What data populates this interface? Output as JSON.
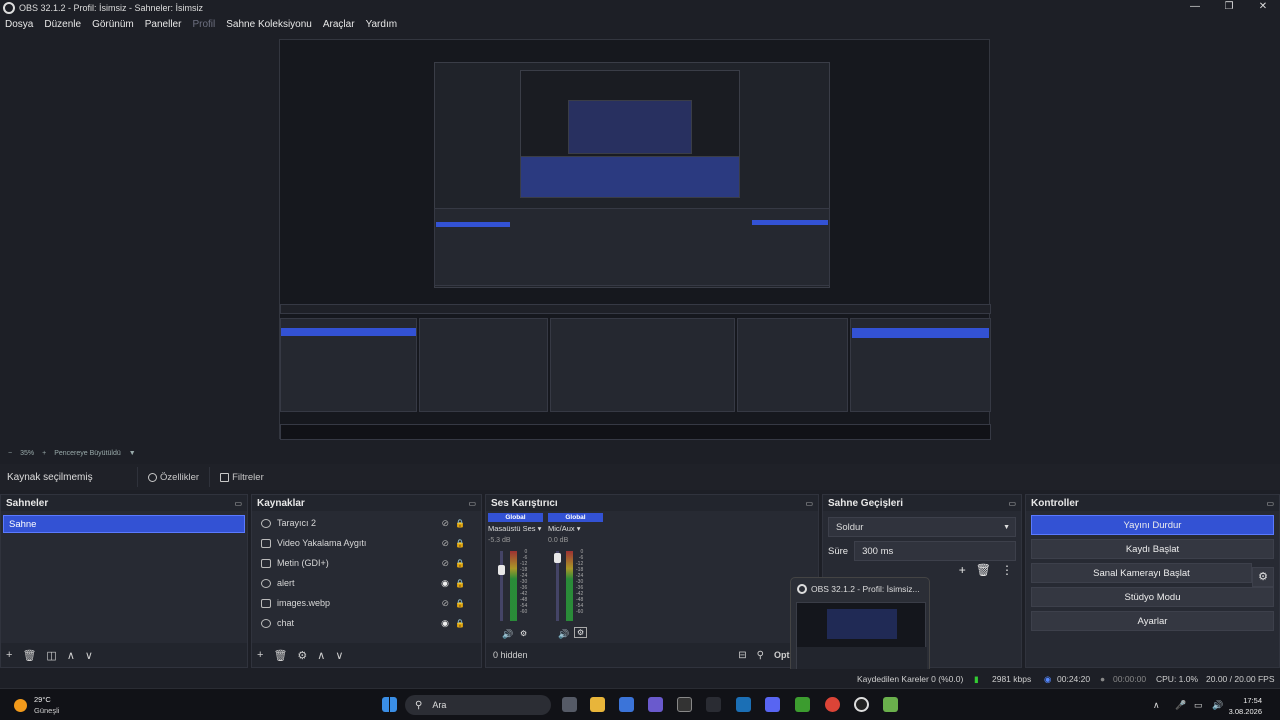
{
  "window": {
    "title": "OBS 32.1.2 - Profil: İsimsiz - Sahneler: İsimsiz"
  },
  "menu": [
    {
      "label": "Dosya",
      "disabled": false
    },
    {
      "label": "Düzenle",
      "disabled": false
    },
    {
      "label": "Görünüm",
      "disabled": false
    },
    {
      "label": "Paneller",
      "disabled": false
    },
    {
      "label": "Profil",
      "disabled": true
    },
    {
      "label": "Sahne Koleksiyonu",
      "disabled": false
    },
    {
      "label": "Araçlar",
      "disabled": false
    },
    {
      "label": "Yardım",
      "disabled": false
    }
  ],
  "zoom": {
    "minus": "−",
    "value": "35%",
    "plus": "+",
    "fit_label": "Pencereye Büyütüldü"
  },
  "source_bar": {
    "label": "Kaynak seçilmemiş",
    "properties": "Özellikler",
    "filters": "Filtreler"
  },
  "scenes": {
    "title": "Sahneler",
    "items": [
      "Sahne"
    ]
  },
  "sources": {
    "title": "Kaynaklar",
    "items": [
      {
        "name": "Tarayıcı 2",
        "visible": false
      },
      {
        "name": "Video Yakalama Aygıtı",
        "visible": false
      },
      {
        "name": "Metin (GDI+)",
        "visible": false
      },
      {
        "name": "alert",
        "visible": true
      },
      {
        "name": "images.webp",
        "visible": false
      },
      {
        "name": "chat",
        "visible": true
      }
    ]
  },
  "mixer": {
    "title": "Ses Karıştırıcı",
    "channels": [
      {
        "badge": "Global",
        "name": "Masaüstü Ses",
        "db": "-5.3 dB"
      },
      {
        "badge": "Global",
        "name": "Mic/Aux",
        "db": "0.0 dB"
      }
    ],
    "ticks": [
      "0",
      "-6",
      "-12",
      "-18",
      "-24",
      "-30",
      "-36",
      "-42",
      "-48",
      "-54",
      "-60"
    ],
    "hidden_label": "0 hidden",
    "options_label": "Options"
  },
  "transitions": {
    "title": "Sahne Geçişleri",
    "selected": "Soldur",
    "duration_label": "Süre",
    "duration_value": "300 ms"
  },
  "controls": {
    "title": "Kontroller",
    "buttons": [
      "Yayını Durdur",
      "Kaydı Başlat",
      "Sanal Kamerayı Başlat",
      "Stüdyo Modu",
      "Ayarlar"
    ]
  },
  "thumbnail_popup": {
    "title": "OBS 32.1.2 - Profil: İsimsiz..."
  },
  "status": {
    "dropped": "Kaydedilen Kareler 0 (%0.0)",
    "bitrate": "2981 kbps",
    "stream_time": "00:24:20",
    "rec_time": "00:00:00",
    "cpu": "CPU: 1.0%",
    "fps": "20.00 / 20.00 FPS"
  },
  "taskbar": {
    "weather_temp": "29°C",
    "weather_desc": "Güneşli",
    "search_placeholder": "Ara",
    "time": "17:54",
    "date": "3.08.2026"
  },
  "colors": {
    "accent": "#3352d4",
    "panel": "#272a33",
    "background": "#1d1f26"
  }
}
